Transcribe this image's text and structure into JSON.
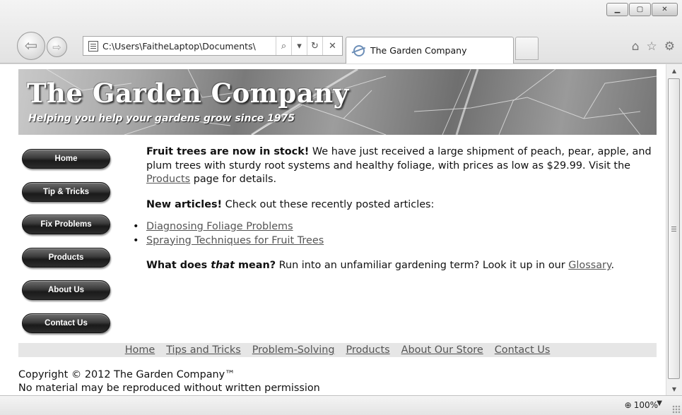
{
  "browser": {
    "address_url": "C:\\Users\\FaitheLaptop\\Documents\\",
    "tab_title": "The Garden Company",
    "zoom": "100%",
    "icons": [
      "back-icon",
      "forward-icon",
      "page-icon",
      "search-icon",
      "refresh-icon",
      "stop-icon",
      "ie-icon",
      "home-icon",
      "favorites-icon",
      "gear-icon",
      "zoom-icon"
    ]
  },
  "banner": {
    "title": "The Garden Company",
    "tagline": "Helping you help your gardens grow since 1975"
  },
  "sidebar": {
    "items": [
      {
        "label": "Home"
      },
      {
        "label": "Tip & Tricks"
      },
      {
        "label": "Fix Problems"
      },
      {
        "label": "Products"
      },
      {
        "label": "About Us"
      },
      {
        "label": "Contact Us"
      }
    ]
  },
  "main": {
    "p1_bold": "Fruit trees are now in stock!",
    "p1_text": " We have just received a large shipment of peach, pear, apple, and plum trees with sturdy root systems and healthy foliage, with prices as low as $29.99. Visit the ",
    "p1_link": "Products",
    "p1_end": " page for details.",
    "p2_bold": "New articles!",
    "p2_text": " Check out these recently posted articles:",
    "articles": [
      "Diagnosing Foliage Problems",
      "Spraying Techniques for Fruit Trees"
    ],
    "p3_bold_a": "What does ",
    "p3_bold_italic": "that",
    "p3_bold_b": " mean?",
    "p3_text": " Run into an unfamiliar gardening term? Look it up in our ",
    "p3_link": "Glossary",
    "p3_end": "."
  },
  "footer": {
    "links": [
      "Home",
      "Tips and Tricks",
      "Problem-Solving",
      "Products",
      "About Our Store",
      "Contact Us"
    ],
    "copyright_line1": "Copyright © 2012 The Garden Company™",
    "copyright_line2": "No material may be reproduced without written permission"
  }
}
